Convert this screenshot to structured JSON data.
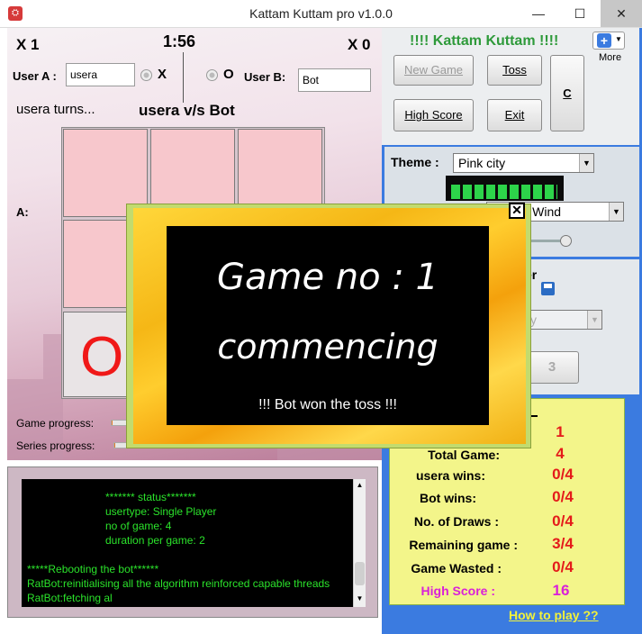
{
  "window": {
    "title": "Kattam Kuttam pro v1.0.0",
    "minimize": "—",
    "maximize": "☐",
    "close": "✕",
    "app_icon": "⛭"
  },
  "game": {
    "score_a": "X 1",
    "timer": "1:56",
    "score_b": "X 0",
    "user_a_label": "User A :",
    "user_a_value": "usera",
    "mark_a": "X",
    "mark_b": "O",
    "user_b_label": "User B:",
    "user_b_value": "Bot",
    "turn_text": "usera turns...",
    "versus_text": "usera v/s Bot",
    "row_a_label": "A:",
    "big_o": "O",
    "game_progress_label": "Game progress:",
    "series_progress_label": "Series progress:",
    "game_progress": 0.02,
    "series_progress": 0.05
  },
  "console": {
    "lines": [
      "******* status*******",
      "usertype:  Single Player",
      "no of game:  4",
      "duration per game:   2",
      "",
      "*****Rebooting the bot******",
      "RatBot:reinitialising all the algorithm reinforced capable threads",
      "RatBot:fetching al"
    ]
  },
  "right": {
    "app_heading": "!!!! Kattam Kuttam !!!!",
    "more_label": "More",
    "new_game": "New Game",
    "toss": "Toss",
    "c_button": "C",
    "high_score_btn": "High Score",
    "exit": "Exit",
    "theme_label": "Theme :",
    "theme_value": "Pink city",
    "music_value": "Ocean Wind",
    "partial_er": "er",
    "partial_y": "y",
    "partial_3": "3"
  },
  "stats": {
    "rows": [
      {
        "label": "",
        "value": "1"
      },
      {
        "label": "Total Game:",
        "value": "4"
      },
      {
        "label": "usera wins:",
        "value": "0/4"
      },
      {
        "label": "Bot wins:",
        "value": "0/4"
      },
      {
        "label": "No. of Draws :",
        "value": "0/4"
      },
      {
        "label": "Remaining game :",
        "value": "3/4"
      },
      {
        "label": "Game Wasted :",
        "value": "0/4"
      },
      {
        "label": "High Score :",
        "value": "16"
      }
    ],
    "how_to_play": "How to play ??"
  },
  "modal": {
    "line1": "Game no : 1",
    "line2": "commencing",
    "toss_result": "!!! Bot won the toss !!!",
    "close": "✕"
  },
  "colors": {
    "accent_blue": "#3b7be0",
    "stat_red": "#e41a1a",
    "high_score_magenta": "#d920d9",
    "console_green": "#2be32b",
    "heading_green": "#2e9a3a"
  }
}
